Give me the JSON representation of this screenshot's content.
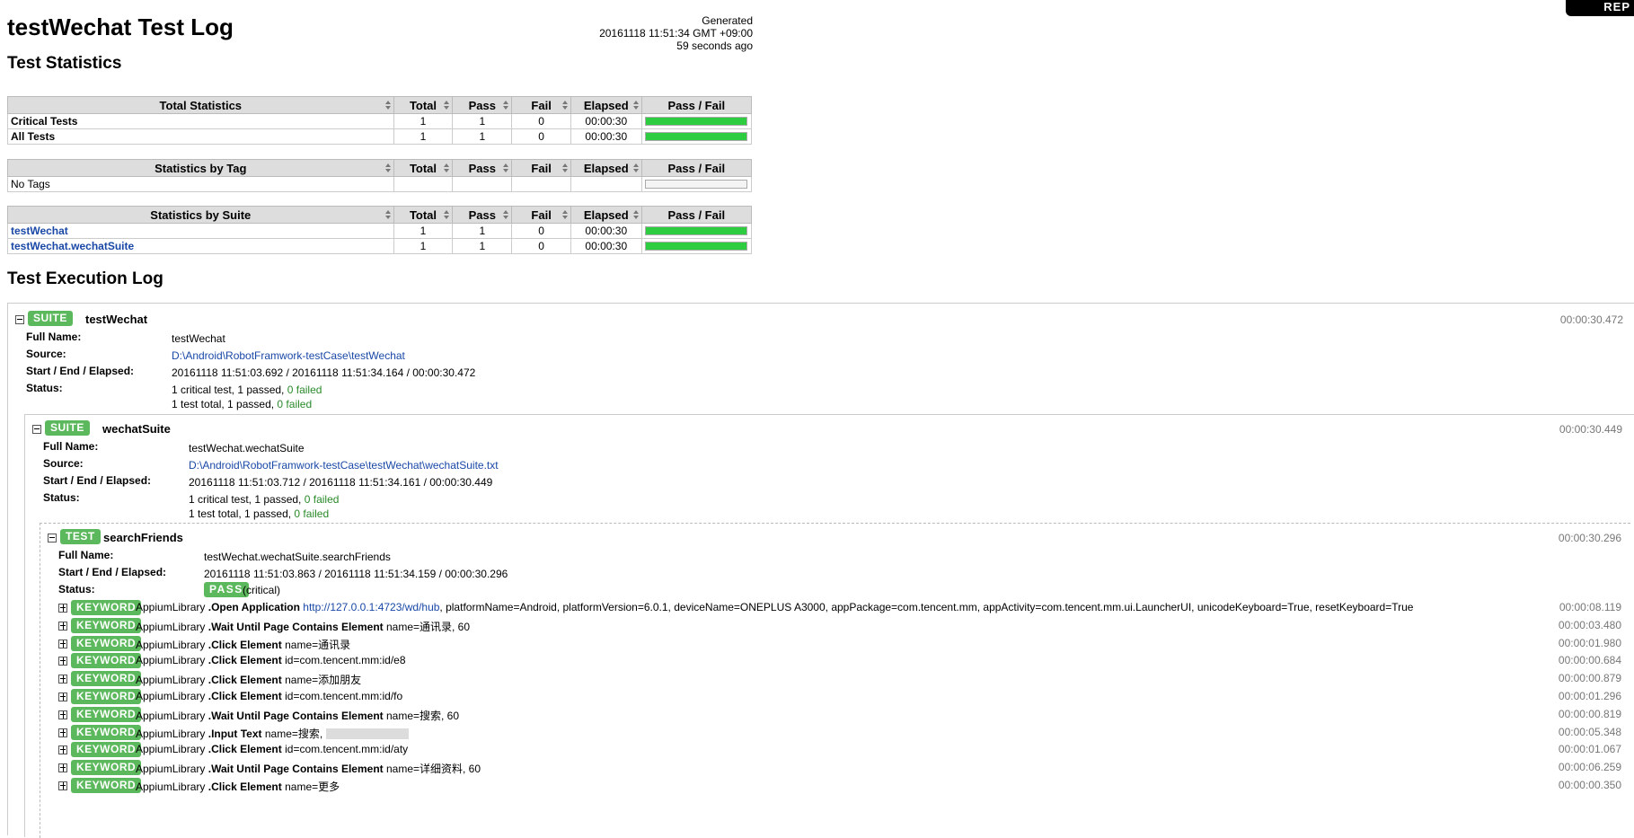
{
  "header": {
    "title": "testWechat Test Log",
    "generated_label": "Generated",
    "generated_time": "20161118 11:51:34 GMT +09:00",
    "generated_ago": "59 seconds ago",
    "report_link": "REP"
  },
  "sections": {
    "statistics": "Test Statistics",
    "execution": "Test Execution Log"
  },
  "columns": {
    "total": "Total",
    "pass": "Pass",
    "fail": "Fail",
    "elapsed": "Elapsed",
    "passfail": "Pass / Fail"
  },
  "total_stats": {
    "heading": "Total Statistics",
    "rows": [
      {
        "name": "Critical Tests",
        "total": "1",
        "pass": "1",
        "fail": "0",
        "elapsed": "00:00:30",
        "pass_ratio": 1
      },
      {
        "name": "All Tests",
        "total": "1",
        "pass": "1",
        "fail": "0",
        "elapsed": "00:00:30",
        "pass_ratio": 1
      }
    ]
  },
  "tag_stats": {
    "heading": "Statistics by Tag",
    "rows": [
      {
        "name": "No Tags",
        "total": "",
        "pass": "",
        "fail": "",
        "elapsed": "",
        "pass_ratio": 0
      }
    ]
  },
  "suite_stats": {
    "heading": "Statistics by Suite",
    "rows": [
      {
        "name": "testWechat",
        "total": "1",
        "pass": "1",
        "fail": "0",
        "elapsed": "00:00:30",
        "pass_ratio": 1
      },
      {
        "name": "testWechat.wechatSuite",
        "total": "1",
        "pass": "1",
        "fail": "0",
        "elapsed": "00:00:30",
        "pass_ratio": 1
      }
    ]
  },
  "meta_labels": {
    "full_name": "Full Name:",
    "source": "Source:",
    "times": "Start / End / Elapsed:",
    "status": "Status:"
  },
  "suite1": {
    "type": "SUITE",
    "name": "testWechat",
    "elapsed": "00:00:30.472",
    "full_name": "testWechat",
    "source": "D:\\Android\\RobotFramwork-testCase\\testWechat",
    "times": "20161118 11:51:03.692 / 20161118 11:51:34.164 / 00:00:30.472",
    "status_line1": "1 critical test, 1 passed,",
    "status_line2": "1 test total, 1 passed,",
    "failed": "0 failed"
  },
  "suite2": {
    "type": "SUITE",
    "name": "wechatSuite",
    "elapsed": "00:00:30.449",
    "full_name": "testWechat.wechatSuite",
    "source": "D:\\Android\\RobotFramwork-testCase\\testWechat\\wechatSuite.txt",
    "times": "20161118 11:51:03.712 / 20161118 11:51:34.161 / 00:00:30.449",
    "status_line1": "1 critical test, 1 passed,",
    "status_line2": "1 test total, 1 passed,",
    "failed": "0 failed"
  },
  "test": {
    "type": "TEST",
    "name": "searchFriends",
    "elapsed": "00:00:30.296",
    "full_name": "testWechat.wechatSuite.searchFriends",
    "times": "20161118 11:51:03.863 / 20161118 11:51:34.159 / 00:00:30.296",
    "status": "PASS",
    "status_note": "(critical)"
  },
  "keyword_label": "KEYWORD",
  "keywords": [
    {
      "lib": "AppiumLibrary",
      "kw": "Open Application",
      "url": "http://127.0.0.1:4723/wd/hub",
      "args": ", platformName=Android, platformVersion=6.0.1, deviceName=ONEPLUS A3000, appPackage=com.tencent.mm, appActivity=com.tencent.mm.ui.LauncherUI, unicodeKeyboard=True, resetKeyboard=True",
      "elapsed": "00:00:08.119"
    },
    {
      "lib": "AppiumLibrary",
      "kw": "Wait Until Page Contains Element",
      "url": "",
      "args": "name=通讯录, 60",
      "elapsed": "00:00:03.480"
    },
    {
      "lib": "AppiumLibrary",
      "kw": "Click Element",
      "url": "",
      "args": "name=通讯录",
      "elapsed": "00:00:01.980"
    },
    {
      "lib": "AppiumLibrary",
      "kw": "Click Element",
      "url": "",
      "args": "id=com.tencent.mm:id/e8",
      "elapsed": "00:00:00.684"
    },
    {
      "lib": "AppiumLibrary",
      "kw": "Click Element",
      "url": "",
      "args": "name=添加朋友",
      "elapsed": "00:00:00.879"
    },
    {
      "lib": "AppiumLibrary",
      "kw": "Click Element",
      "url": "",
      "args": "id=com.tencent.mm:id/fo",
      "elapsed": "00:00:01.296"
    },
    {
      "lib": "AppiumLibrary",
      "kw": "Wait Until Page Contains Element",
      "url": "",
      "args": "name=搜索, 60",
      "elapsed": "00:00:00.819"
    },
    {
      "lib": "AppiumLibrary",
      "kw": "Input Text",
      "url": "",
      "args": "name=搜索,",
      "elapsed": "00:00:05.348"
    },
    {
      "lib": "AppiumLibrary",
      "kw": "Click Element",
      "url": "",
      "args": "id=com.tencent.mm:id/aty",
      "elapsed": "00:00:01.067"
    },
    {
      "lib": "AppiumLibrary",
      "kw": "Wait Until Page Contains Element",
      "url": "",
      "args": "name=详细资料, 60",
      "elapsed": "00:00:06.259"
    },
    {
      "lib": "AppiumLibrary",
      "kw": "Click Element",
      "url": "",
      "args": "name=更多",
      "elapsed": "00:00:00.350"
    }
  ]
}
